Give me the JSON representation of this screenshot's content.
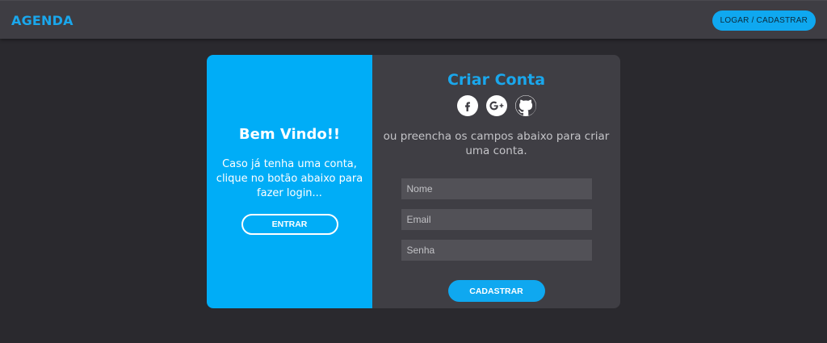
{
  "navbar": {
    "brand": "AGENDA",
    "login_button": "LOGAR / CADASTRAR"
  },
  "welcome_panel": {
    "title": "Bem Vindo!!",
    "message": "Caso já tenha uma conta, clique no botão abaixo para fazer login...",
    "button_label": "ENTRAR"
  },
  "signup_panel": {
    "title": "Criar Conta",
    "social_icons": [
      "facebook-icon",
      "google-plus-icon",
      "github-icon"
    ],
    "subtitle": "ou preencha os campos abaixo para criar uma conta.",
    "fields": {
      "name": {
        "placeholder": "Nome",
        "value": ""
      },
      "email": {
        "placeholder": "Email",
        "value": ""
      },
      "password": {
        "placeholder": "Senha",
        "value": ""
      }
    },
    "submit_label": "CADASTRAR"
  },
  "colors": {
    "accent": "#0fa8f0",
    "welcome_bg": "#00adf7",
    "page_bg": "#2a292e",
    "panel_bg": "#3f3e44",
    "navbar_bg": "#3e3d43",
    "input_bg": "#525157"
  }
}
